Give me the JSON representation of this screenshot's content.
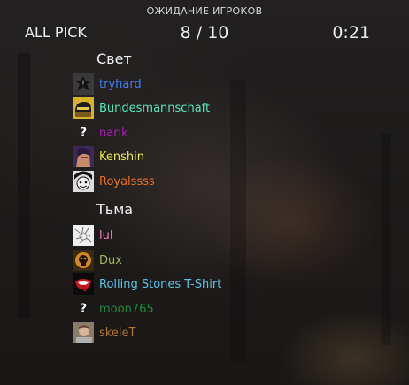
{
  "header": {
    "status": "ОЖИДАНИЕ ИГРОКОВ",
    "mode": "ALL PICK",
    "players_loaded": "8",
    "players_separator": "/",
    "players_total": "10",
    "timer": "0:21"
  },
  "teams": [
    {
      "name": "Свет",
      "players": [
        {
          "name": "tryhard",
          "color": "#3f7ef0",
          "avatar": "emblem-icon"
        },
        {
          "name": "Bundesmannschaft",
          "color": "#57e8bd",
          "avatar": "helmet-icon"
        },
        {
          "name": "narik",
          "color": "#b01cb8",
          "avatar": "unknown-avatar",
          "avatar_text": "?"
        },
        {
          "name": "Kenshin",
          "color": "#eae73a",
          "avatar": "hero-portrait-icon"
        },
        {
          "name": "Royalssss",
          "color": "#f0711c",
          "avatar": "face-portrait-icon"
        }
      ]
    },
    {
      "name": "Тьма",
      "players": [
        {
          "name": "lul",
          "color": "#f07ec4",
          "avatar": "sketch-icon"
        },
        {
          "name": "Dux",
          "color": "#a2b84f",
          "avatar": "skull-icon"
        },
        {
          "name": "Rolling Stones T-Shirt",
          "color": "#5fc4e8",
          "avatar": "lips-logo-icon"
        },
        {
          "name": "moon765",
          "color": "#1f8a3a",
          "avatar": "unknown-avatar",
          "avatar_text": "?"
        },
        {
          "name": "skeleT",
          "color": "#b0782a",
          "avatar": "photo-portrait-icon"
        }
      ]
    }
  ]
}
